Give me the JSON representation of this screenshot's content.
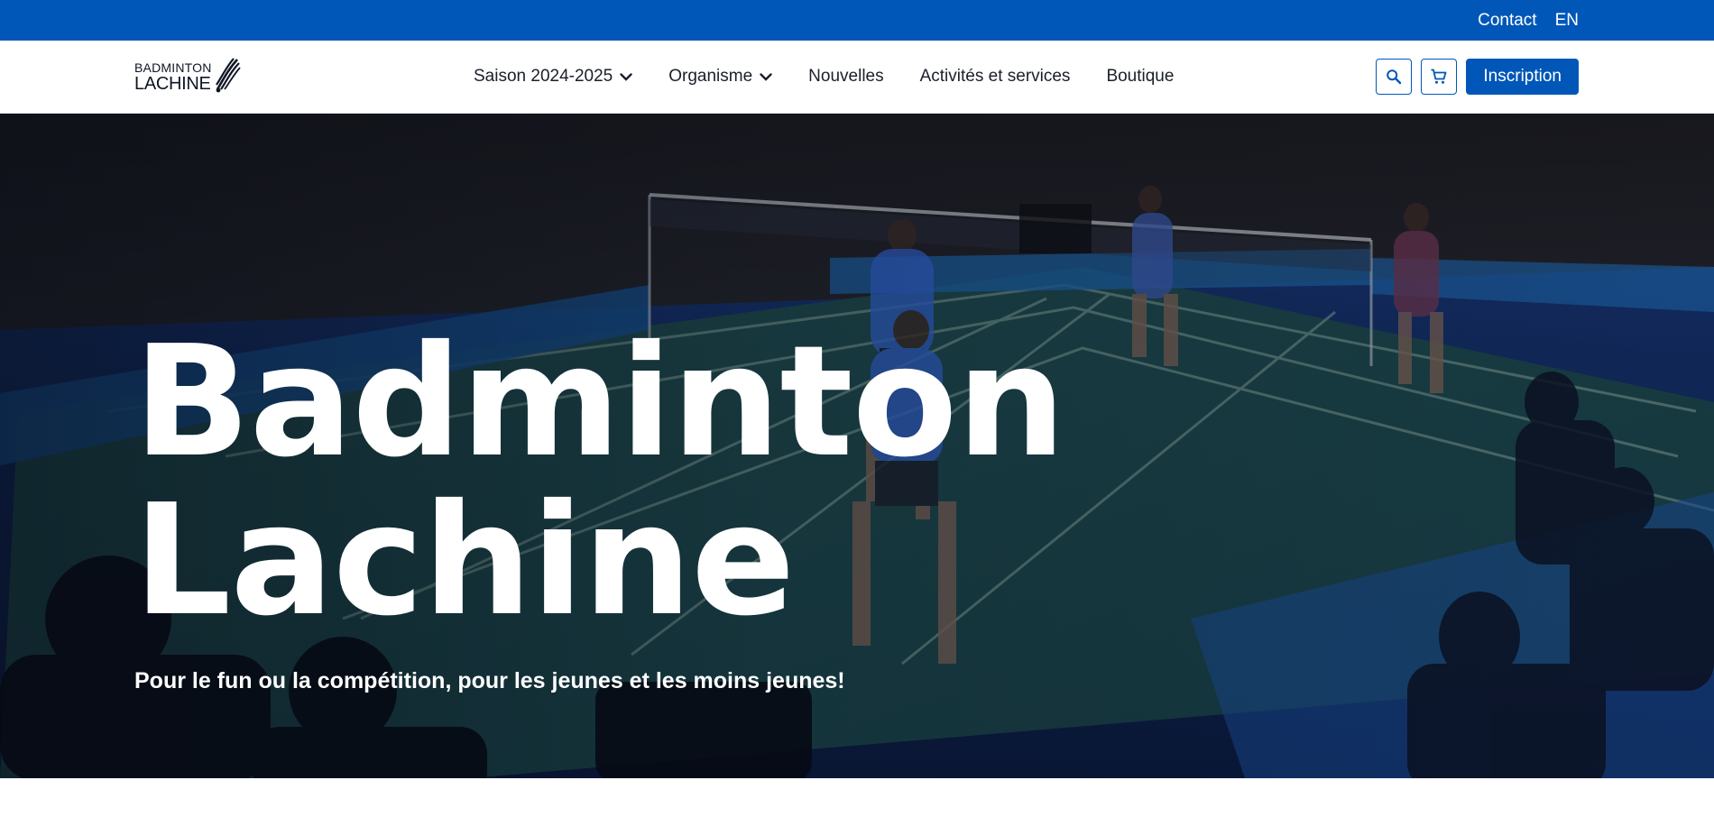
{
  "topbar": {
    "contact_label": "Contact",
    "lang_label": "EN"
  },
  "logo": {
    "line1": "BADMINTON",
    "line2": "LACHINE"
  },
  "nav": {
    "items": [
      {
        "label": "Saison 2024-2025",
        "has_dropdown": true
      },
      {
        "label": "Organisme",
        "has_dropdown": true
      },
      {
        "label": "Nouvelles",
        "has_dropdown": false
      },
      {
        "label": "Activités et services",
        "has_dropdown": false
      },
      {
        "label": "Boutique",
        "has_dropdown": false
      }
    ]
  },
  "actions": {
    "search_icon": "search-icon",
    "cart_icon": "cart-icon",
    "cta_label": "Inscription"
  },
  "hero": {
    "title_line1": "Badminton",
    "title_line2": "Lachine",
    "subtitle": "Pour le fun ou la compétition,  pour les jeunes et les moins jeunes!"
  },
  "colors": {
    "brand_blue": "#0057b8",
    "text_dark": "#1b1f2a",
    "white": "#ffffff"
  }
}
